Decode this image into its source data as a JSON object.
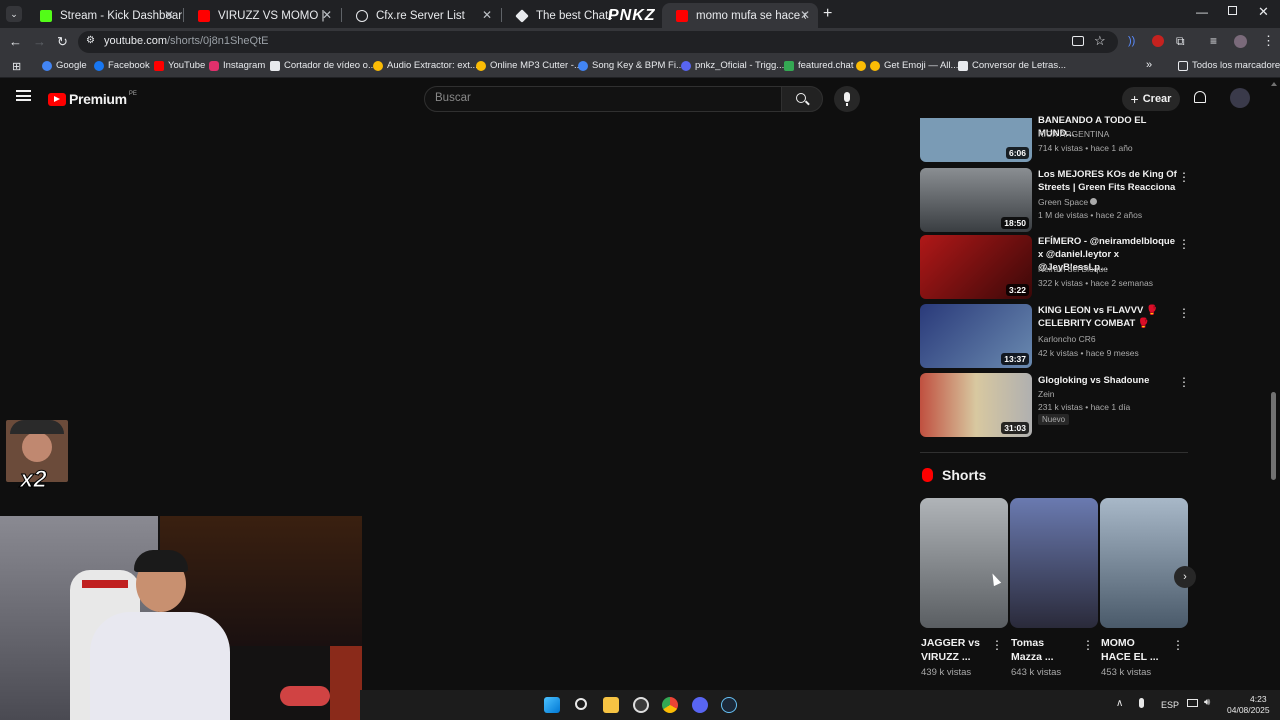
{
  "browser": {
    "tabs": [
      {
        "label": "Stream - Kick Dashboard",
        "color": "#53fc18"
      },
      {
        "label": "VIRUZZ VS MOMO | LA VELADA",
        "color": "#ff0000"
      },
      {
        "label": "Cfx.re Server List",
        "color": "#e8eaed"
      },
      {
        "label": "The best ChatBot and",
        "color": "#e8eaed"
      },
      {
        "label": "momo mufa se hace el malo (t",
        "color": "#ff0000"
      }
    ],
    "overlay_logo": "PNKZ",
    "url_host": "youtube.com",
    "url_path": "/shorts/0j8n1SheQtE",
    "bookmarks": [
      {
        "label": "Google",
        "color": "#4285f4"
      },
      {
        "label": "Facebook",
        "color": "#1877f2"
      },
      {
        "label": "YouTube",
        "color": "#ff0000"
      },
      {
        "label": "Instagram",
        "color": "#e1306c"
      },
      {
        "label": "Cortador de vídeo o...",
        "color": "#e8eaed"
      },
      {
        "label": "Audio Extractor: ext...",
        "color": "#fbbc05"
      },
      {
        "label": "Online MP3 Cutter -...",
        "color": "#fbbc05"
      },
      {
        "label": "Song Key & BPM Fi...",
        "color": "#4285f4"
      },
      {
        "label": "pnkz_Oficial - Trigg...",
        "color": "#5865f2"
      },
      {
        "label": "featured.chat",
        "color": "#34a853"
      },
      {
        "label": "Get Emoji — All...",
        "color": "#fbbc05"
      },
      {
        "label": "Conversor de Letras...",
        "color": "#e8eaed"
      }
    ],
    "all_bookmarks": "Todos los marcadores"
  },
  "youtube": {
    "logo_text": "Premium",
    "logo_region": "PE",
    "search_placeholder": "Buscar",
    "create_label": "Crear",
    "videos": [
      {
        "title": "BANEANDO A TODO EL MUND...",
        "channel": "KICK ARGENTINA",
        "meta": "714 k vistas • hace 1 año",
        "duration": "6:06",
        "thumb": "#7a9bb5"
      },
      {
        "title": "Los MEJORES KOs de King Of Streets | Green Fits Reacciona",
        "channel": "Green Space",
        "meta": "1 M de vistas • hace 2 años",
        "duration": "18:50",
        "thumb": "#5a5e62"
      },
      {
        "title": "EFÍMERO - @neiramdelbloque x @daniel.leytor x @JeyBlessLp...",
        "channel": "Neiram del Bloque",
        "meta": "322 k vistas • hace 2 semanas",
        "duration": "3:22",
        "thumb": "#8a1414"
      },
      {
        "title": "KING LEON vs FLAVVV 🥊 CELEBRITY COMBAT 🥊",
        "channel": "Karloncho CR6",
        "meta": "42 k vistas • hace 9 meses",
        "duration": "13:37",
        "thumb": "#3b4a8a"
      },
      {
        "title": "Glogloking vs Shadoune",
        "channel": "Zein",
        "meta": "231 k vistas • hace 1 día",
        "duration": "31:03",
        "thumb": "#a88a5a",
        "badge": "Nuevo"
      }
    ],
    "shorts_heading": "Shorts",
    "shorts": [
      {
        "title": "JAGGER vs VIRUZZ ...",
        "views": "439 k vistas",
        "thumb": "#8d8f94"
      },
      {
        "title": "Tomas Mazza ...",
        "views": "643 k vistas",
        "thumb": "#4a5a8a"
      },
      {
        "title": "MOMO HACE EL ...",
        "views": "453 k vistas",
        "thumb": "#7a8a9a"
      }
    ]
  },
  "overlay": {
    "emote_text": "x2"
  },
  "taskbar": {
    "language": "ESP",
    "time": "4:23",
    "date": "04/08/2025"
  }
}
